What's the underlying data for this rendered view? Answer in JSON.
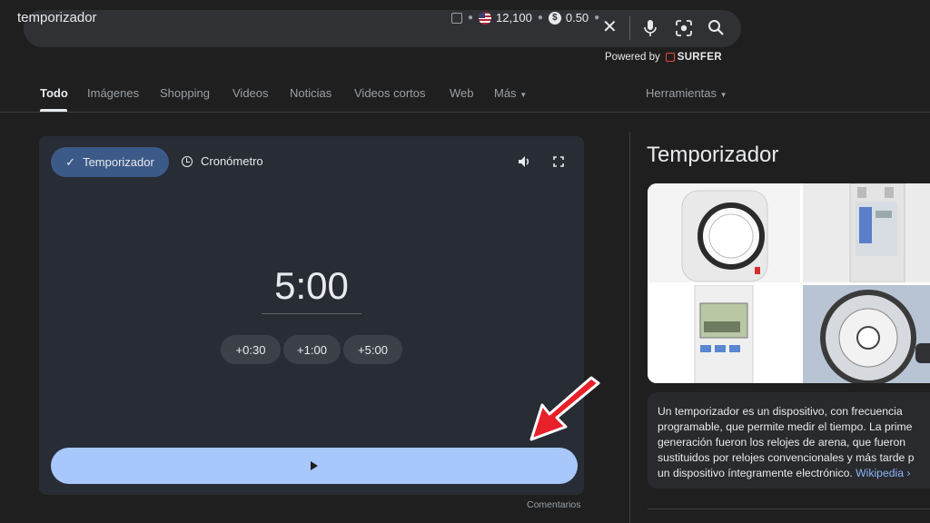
{
  "search": {
    "query": "temporizador",
    "ext_value1": "12,100",
    "ext_value2": "0.50",
    "powered_by": "Powered by",
    "brand": "SURFER"
  },
  "icons": {
    "clear": "close-icon",
    "mic": "microphone-icon",
    "lens": "camera-search-icon",
    "search": "search-icon"
  },
  "tabs": [
    {
      "label": "Todo"
    },
    {
      "label": "Imágenes"
    },
    {
      "label": "Shopping"
    },
    {
      "label": "Videos"
    },
    {
      "label": "Noticias"
    },
    {
      "label": "Videos cortos"
    },
    {
      "label": "Web"
    },
    {
      "label": "Más"
    }
  ],
  "tools_label": "Herramientas",
  "timer": {
    "tab_timer": "Temporizador",
    "tab_stopwatch": "Cronómetro",
    "time": "5:00",
    "add_buttons": [
      "+0:30",
      "+1:00",
      "+5:00"
    ],
    "feedback": "Comentarios"
  },
  "knowledge_panel": {
    "title": "Temporizador",
    "description_lines": [
      "Un temporizador es un dispositivo, con frecuencia",
      "programable, que permite medir el tiempo. La prime",
      "generación fueron los relojes de arena, que fueron",
      "sustituidos por relojes convencionales y más tarde p",
      "un dispositivo íntegramente electrónico. "
    ],
    "source_link": "Wikipedia ›"
  },
  "colors": {
    "background": "#1f1f1f",
    "card": "#282c34",
    "play_bar": "#a8c7fa",
    "active_pill": "#3c5a87",
    "annotation_arrow": "#e8202a"
  }
}
